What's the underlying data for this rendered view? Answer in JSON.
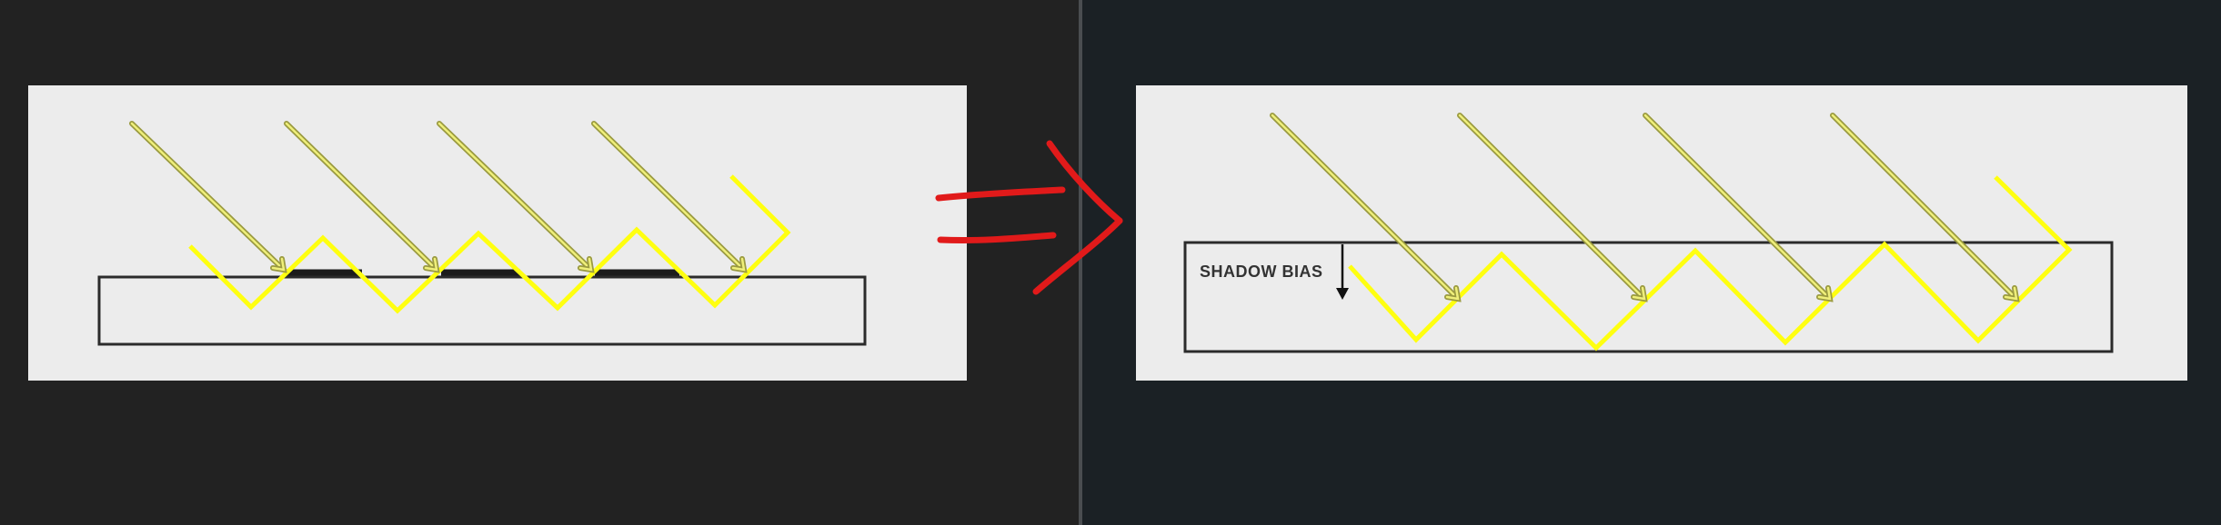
{
  "diagrams": {
    "before": {
      "ray_count": 4,
      "contact_marks": 3
    },
    "after": {
      "ray_count": 4,
      "annotation": "SHADOW BIAS"
    }
  },
  "icons": {
    "transition": "double-arrow-icon"
  },
  "colors": {
    "panel": "#ececec",
    "surface_outline": "#2b2b2b",
    "shadow_zigzag": "#ffff10",
    "light_ray": "#efef7a",
    "arrow": "#e11a1a",
    "left_background": "#222222",
    "right_background": "#1b2125"
  }
}
